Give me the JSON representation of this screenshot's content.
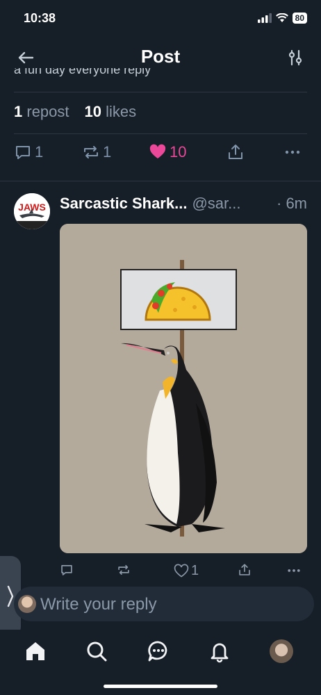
{
  "status_bar": {
    "time": "10:38",
    "battery": "80"
  },
  "header": {
    "title": "Post"
  },
  "main_post": {
    "cut_text": "a fun day everyone reply",
    "stats": {
      "reposts": "1",
      "reposts_label": "repost",
      "likes": "10",
      "likes_label": "likes"
    },
    "actions": {
      "replies": "1",
      "reposts": "1",
      "likes": "10"
    }
  },
  "reply_post": {
    "author": "Sarcastic Shark...",
    "handle": "@sar...",
    "time": "· 6m",
    "avatar_text": "JAWS",
    "actions": {
      "likes": "1"
    }
  },
  "reply_bar": {
    "placeholder": "Write your reply"
  },
  "colors": {
    "background": "#161e27",
    "like": "#ec4899",
    "muted": "#8a98a8"
  }
}
